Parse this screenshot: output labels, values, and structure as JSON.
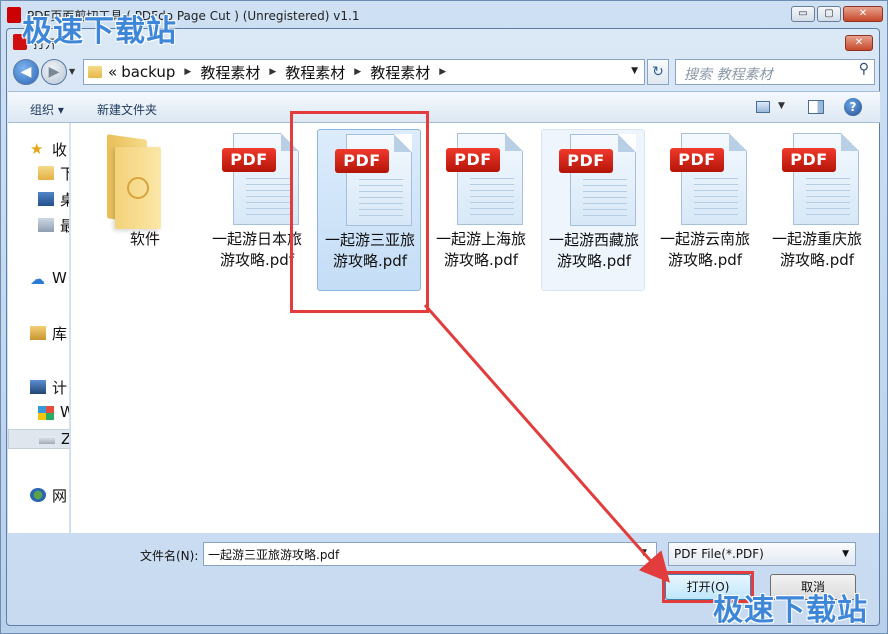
{
  "app": {
    "title": "PDF页面剪切工具 ( PDFdo Page Cut )  (Unregistered) v1.1",
    "window_buttons": [
      "▭",
      "▢",
      "✕"
    ]
  },
  "watermark": "极速下载站",
  "dialog": {
    "title": "打开",
    "close_glyph": "✕"
  },
  "address": {
    "prefix": "«",
    "crumbs": [
      "backup",
      "教程素材",
      "教程素材",
      "教程素材"
    ],
    "search_placeholder": "搜索 教程素材"
  },
  "toolbar": {
    "organize": "组织 ▾",
    "new_folder": "新建文件夹",
    "help": "?"
  },
  "nav": {
    "items": [
      {
        "label": "收"
      },
      {
        "label": "下"
      },
      {
        "label": "桌"
      },
      {
        "label": "最"
      },
      {
        "label": "W"
      },
      {
        "label": "库"
      },
      {
        "label": "计"
      },
      {
        "label": "W"
      },
      {
        "label": "Z"
      },
      {
        "label": "网"
      }
    ]
  },
  "files": {
    "pdf_tag": "PDF",
    "items": [
      {
        "name": "软件"
      },
      {
        "name": "一起游日本旅游攻略.pdf"
      },
      {
        "name": "一起游三亚旅游攻略.pdf"
      },
      {
        "name": "一起游上海旅游攻略.pdf"
      },
      {
        "name": "一起游西藏旅游攻略.pdf"
      },
      {
        "name": "一起游云南旅游攻略.pdf"
      },
      {
        "name": "一起游重庆旅游攻略.pdf"
      }
    ]
  },
  "bottom": {
    "filename_label": "文件名(N):",
    "filename_value": "一起游三亚旅游攻略.pdf",
    "filetype": "PDF File(*.PDF)",
    "open_button": "打开(O)",
    "cancel_button": "取消"
  },
  "colors": {
    "highlight": "#e23c3c",
    "pdf_tag": "#d81e10",
    "selection": "#c4ddf6"
  }
}
